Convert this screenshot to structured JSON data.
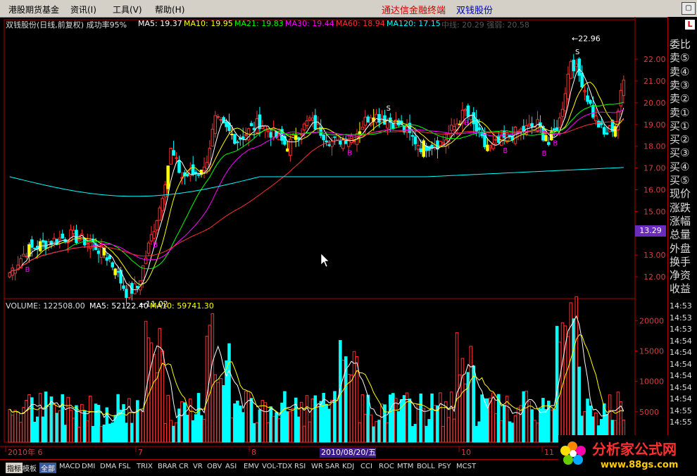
{
  "menubar": {
    "items": [
      "港股期货基金",
      "资讯(I)",
      "工具(V)",
      "帮助(H)"
    ],
    "brand": "通达信金融终端",
    "stock": "双钱股份",
    "window_button": "▢"
  },
  "header": {
    "title": "双钱股份(日线,前复权) 成功率95%",
    "ma5": "MA5: 19.37",
    "ma10": "MA10: 19.95",
    "ma21": "MA21: 19.83",
    "ma30": "MA30: 19.44",
    "ma60": "MA60: 18.94",
    "ma120": "MA120: 17.15",
    "extra": "中线: 20.29  强弱: 20.58"
  },
  "volume_header": {
    "volume": "VOLUME: 122508.00",
    "ma5": "MA5: 52122.40",
    "ma10": "MA10: 59741.30"
  },
  "price_axis": [
    "22.00",
    "21.00",
    "20.00",
    "19.00",
    "18.00",
    "17.00",
    "16.00",
    "15.00",
    "14.00",
    "13.00",
    "12.00"
  ],
  "volume_axis": [
    "20000",
    "15000",
    "10000",
    "5000"
  ],
  "current_price": "13.29",
  "annotations": {
    "high": "22.96",
    "low": "11.02",
    "buy": "B",
    "sell": "S"
  },
  "date_axis": {
    "labels": [
      "2010年 6",
      "7",
      "8",
      "10",
      "11"
    ],
    "selected": "2010/08/20/五"
  },
  "side_panel": {
    "labels": [
      "委比",
      "卖⑤",
      "卖④",
      "卖③",
      "卖②",
      "卖①",
      "买①",
      "买②",
      "买③",
      "买④",
      "买⑤",
      "现价",
      "涨跌",
      "涨幅",
      "总量",
      "外盘",
      "换手",
      "净资",
      "收益"
    ],
    "times": [
      "14:53",
      "14:53",
      "14:53",
      "14:54",
      "14:54",
      "14:54",
      "14:54",
      "14:54",
      "14:54",
      "14:55",
      "14:55"
    ],
    "top_icon": "L"
  },
  "tabs": [
    "指标",
    "模板",
    "全部",
    "MACD",
    "DMI",
    "DMA",
    "FSL",
    "TRIX",
    "BRAR",
    "CR",
    "VR",
    "OBV",
    "ASI",
    "EMV",
    "VOL-TDX",
    "RSI",
    "WR",
    "SAR",
    "KDJ",
    "CCI",
    "ROC",
    "MTM",
    "BOLL",
    "PSY",
    "MCST"
  ],
  "logo": {
    "name": "分析家公式网",
    "url": "www.88gs.com"
  },
  "colors": {
    "up": "#ff3030",
    "down": "#00ffff",
    "signal": "#ffff00",
    "ma5": "#ffffff",
    "ma10": "#ffff00",
    "ma21": "#00ff00",
    "ma30": "#ff00ff",
    "ma60": "#ff3030",
    "ma120": "#00ffff"
  }
}
